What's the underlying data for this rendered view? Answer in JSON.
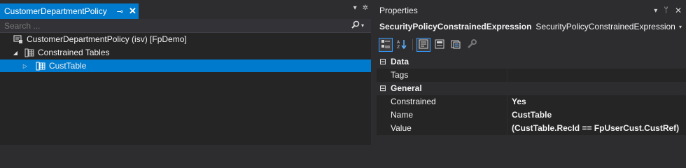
{
  "solution_explorer": {
    "tab_title": "CustomerDepartmentPolicy",
    "pin_glyph": "⊸",
    "close_glyph": "✕",
    "menu_glyph": "▾",
    "settings_glyph": "✲",
    "search_placeholder": "Search ...",
    "search_glyph": "⚲",
    "search_drop_glyph": "▾",
    "tree": [
      {
        "label": "CustomerDepartmentPolicy (isv) [FpDemo]",
        "expander": "",
        "icon": "policy-icon"
      },
      {
        "label": "Constrained Tables",
        "expander": "◢",
        "icon": "table-group-icon"
      },
      {
        "label": "CustTable",
        "expander": "▷",
        "icon": "table-icon",
        "selected": true
      }
    ]
  },
  "properties": {
    "title": "Properties",
    "menu_glyph": "▾",
    "pin_glyph": "ᛘ",
    "close_glyph": "✕",
    "object_name": "SecurityPolicyConstrainedExpression",
    "object_type": "SecurityPolicyConstrainedExpression",
    "object_drop_glyph": "▾",
    "toolbar": [
      "categorized",
      "alphabetical",
      "properties",
      "events",
      "property-pages",
      "wrench"
    ],
    "categories": [
      {
        "name": "Data",
        "toggle": "⊟",
        "rows": [
          {
            "name": "Tags",
            "value": ""
          }
        ]
      },
      {
        "name": "General",
        "toggle": "⊟",
        "rows": [
          {
            "name": "Constrained",
            "value": "Yes"
          },
          {
            "name": "Name",
            "value": "CustTable"
          },
          {
            "name": "Value",
            "value": "(CustTable.RecId == FpUserCust.CustRef)"
          }
        ]
      }
    ]
  },
  "colors": {
    "accent": "#007acc",
    "background": "#2d2d30",
    "panel": "#252526"
  }
}
